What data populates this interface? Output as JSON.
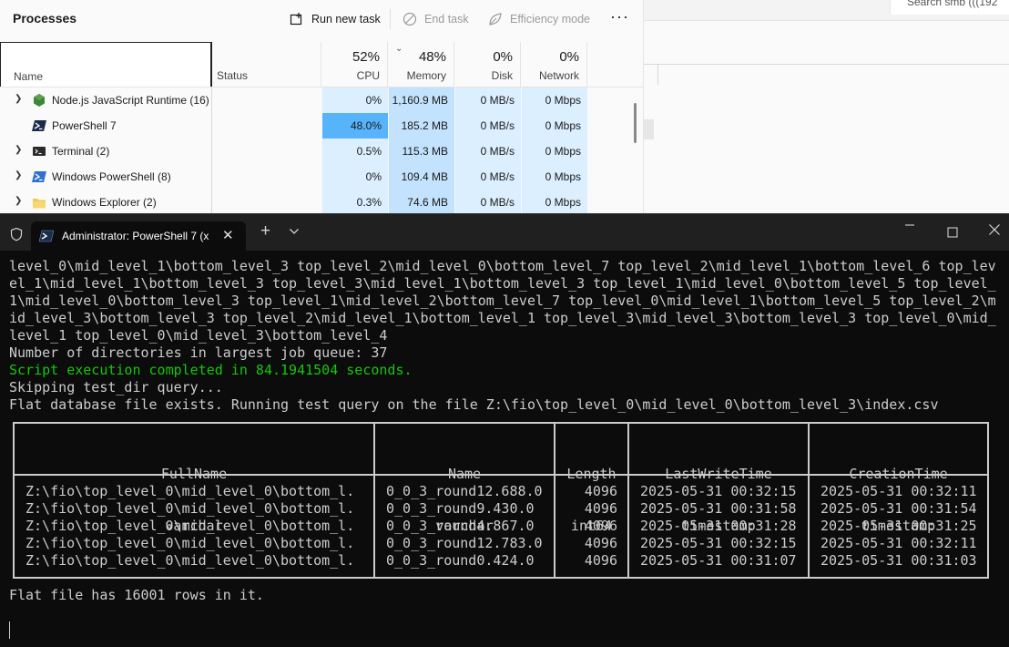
{
  "task_manager": {
    "title": "Processes",
    "toolbar": {
      "run_new_task": "Run new task",
      "end_task": "End task",
      "efficiency_mode": "Efficiency mode",
      "more": "···"
    },
    "columns": {
      "name": "Name",
      "status": "Status",
      "cpu": {
        "percent": "52%",
        "label": "CPU"
      },
      "memory": {
        "percent": "48%",
        "label": "Memory"
      },
      "disk": {
        "percent": "0%",
        "label": "Disk"
      },
      "network": {
        "percent": "0%",
        "label": "Network"
      }
    },
    "rows": [
      {
        "name": "Node.js JavaScript Runtime (16)",
        "icon": "nodejs-icon",
        "expandable": true,
        "cpu": "0%",
        "memory": "1,160.9 MB",
        "disk": "0 MB/s",
        "network": "0 Mbps"
      },
      {
        "name": "PowerShell 7",
        "icon": "powershell-icon",
        "expandable": false,
        "cpu": "48.0%",
        "memory": "185.2 MB",
        "disk": "0 MB/s",
        "network": "0 Mbps"
      },
      {
        "name": "Terminal (2)",
        "icon": "terminal-icon",
        "expandable": true,
        "cpu": "0.5%",
        "memory": "115.3 MB",
        "disk": "0 MB/s",
        "network": "0 Mbps"
      },
      {
        "name": "Windows PowerShell (8)",
        "icon": "windows-powershell-icon",
        "expandable": true,
        "cpu": "0%",
        "memory": "109.4 MB",
        "disk": "0 MB/s",
        "network": "0 Mbps"
      },
      {
        "name": "Windows Explorer (2)",
        "icon": "folder-icon",
        "expandable": true,
        "cpu": "0.3%",
        "memory": "74.6 MB",
        "disk": "0 MB/s",
        "network": "0 Mbps"
      }
    ]
  },
  "right_pane": {
    "search_text": "Search smb (((192"
  },
  "terminal": {
    "tab_title": "Administrator: PowerShell 7 (x",
    "output_lines": [
      "level_0\\mid_level_1\\bottom_level_3 top_level_2\\mid_level_0\\bottom_level_7 top_level_2\\mid_level_1\\bottom_level_6 top_lev",
      "el_1\\mid_level_1\\bottom_level_3 top_level_3\\mid_level_1\\bottom_level_3 top_level_1\\mid_level_0\\bottom_level_5 top_level_",
      "1\\mid_level_0\\bottom_level_3 top_level_1\\mid_level_2\\bottom_level_7 top_level_0\\mid_level_1\\bottom_level_5 top_level_2\\m",
      "id_level_3\\bottom_level_3 top_level_2\\mid_level_1\\bottom_level_1 top_level_3\\mid_level_3\\bottom_level_3 top_level_0\\mid_",
      "level_1 top_level_0\\mid_level_3\\bottom_level_4",
      "Number of directories in largest job queue: 37",
      "Script execution completed in 84.1941504 seconds.",
      "Skipping test_dir query...",
      "Flat database file exists. Running test query on the file Z:\\fio\\top_level_0\\mid_level_0\\bottom_level_3\\index.csv"
    ],
    "table": {
      "headers": [
        {
          "name": "FullName",
          "type": "varchar"
        },
        {
          "name": "Name",
          "type": "varchar"
        },
        {
          "name": "Length",
          "type": "int64"
        },
        {
          "name": "LastWriteTime",
          "type": "timestamp"
        },
        {
          "name": "CreationTime",
          "type": "timestamp"
        }
      ],
      "rows": [
        [
          "Z:\\fio\\top_level_0\\mid_level_0\\bottom_l.",
          "0_0_3_round12.688.0",
          "4096",
          "2025-05-31 00:32:15",
          "2025-05-31 00:32:11"
        ],
        [
          "Z:\\fio\\top_level_0\\mid_level_0\\bottom_l.",
          "0_0_3_round9.430.0",
          "4096",
          "2025-05-31 00:31:58",
          "2025-05-31 00:31:54"
        ],
        [
          "Z:\\fio\\top_level_0\\mid_level_0\\bottom_l.",
          "0_0_3_round4.867.0",
          "4096",
          "2025-05-31 00:31:28",
          "2025-05-31 00:31:25"
        ],
        [
          "Z:\\fio\\top_level_0\\mid_level_0\\bottom_l.",
          "0_0_3_round12.783.0",
          "4096",
          "2025-05-31 00:32:15",
          "2025-05-31 00:32:11"
        ],
        [
          "Z:\\fio\\top_level_0\\mid_level_0\\bottom_l.",
          "0_0_3_round0.424.0",
          "4096",
          "2025-05-31 00:31:07",
          "2025-05-31 00:31:03"
        ]
      ]
    },
    "footer_line": "Flat file has 16001 rows in it."
  },
  "colors": {
    "console_bg": "#0c0c0c",
    "console_text": "#cccccc",
    "success_green": "#16c60c",
    "cpu_hot": "#57b4fb",
    "heat_light": "#dcefff",
    "heat_mem": "#c2e2fd"
  }
}
